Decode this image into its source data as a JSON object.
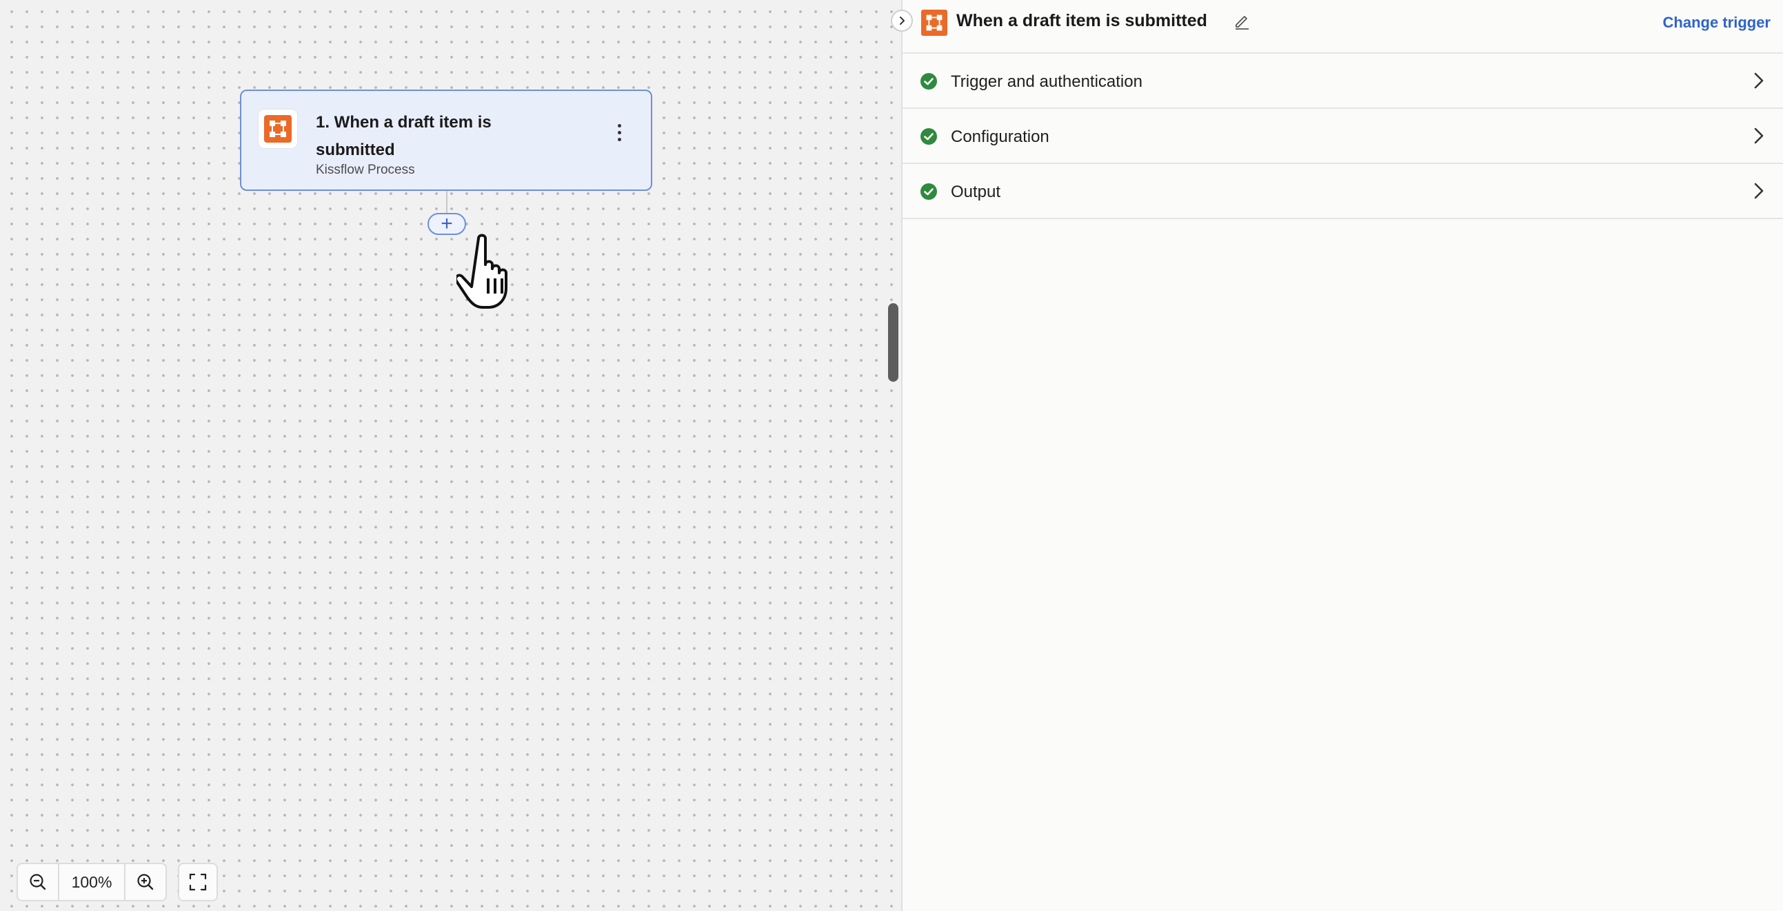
{
  "canvas": {
    "step": {
      "title": "1. When a draft item is submitted",
      "app_name": "Kissflow Process",
      "app_icon": "kissflow-logo-icon"
    },
    "add_step_symbol": "+",
    "zoom": {
      "value": "100%"
    }
  },
  "panel": {
    "title": "When a draft item is submitted",
    "change_trigger_label": "Change trigger",
    "sections": [
      {
        "label": "Trigger and authentication",
        "status": "complete"
      },
      {
        "label": "Configuration",
        "status": "complete"
      },
      {
        "label": "Output",
        "status": "complete"
      }
    ]
  },
  "colors": {
    "brand_orange": "#ea6a28",
    "accent_blue": "#2f64c6",
    "success_green": "#2f8a3e",
    "card_border": "#6c8fd8"
  }
}
